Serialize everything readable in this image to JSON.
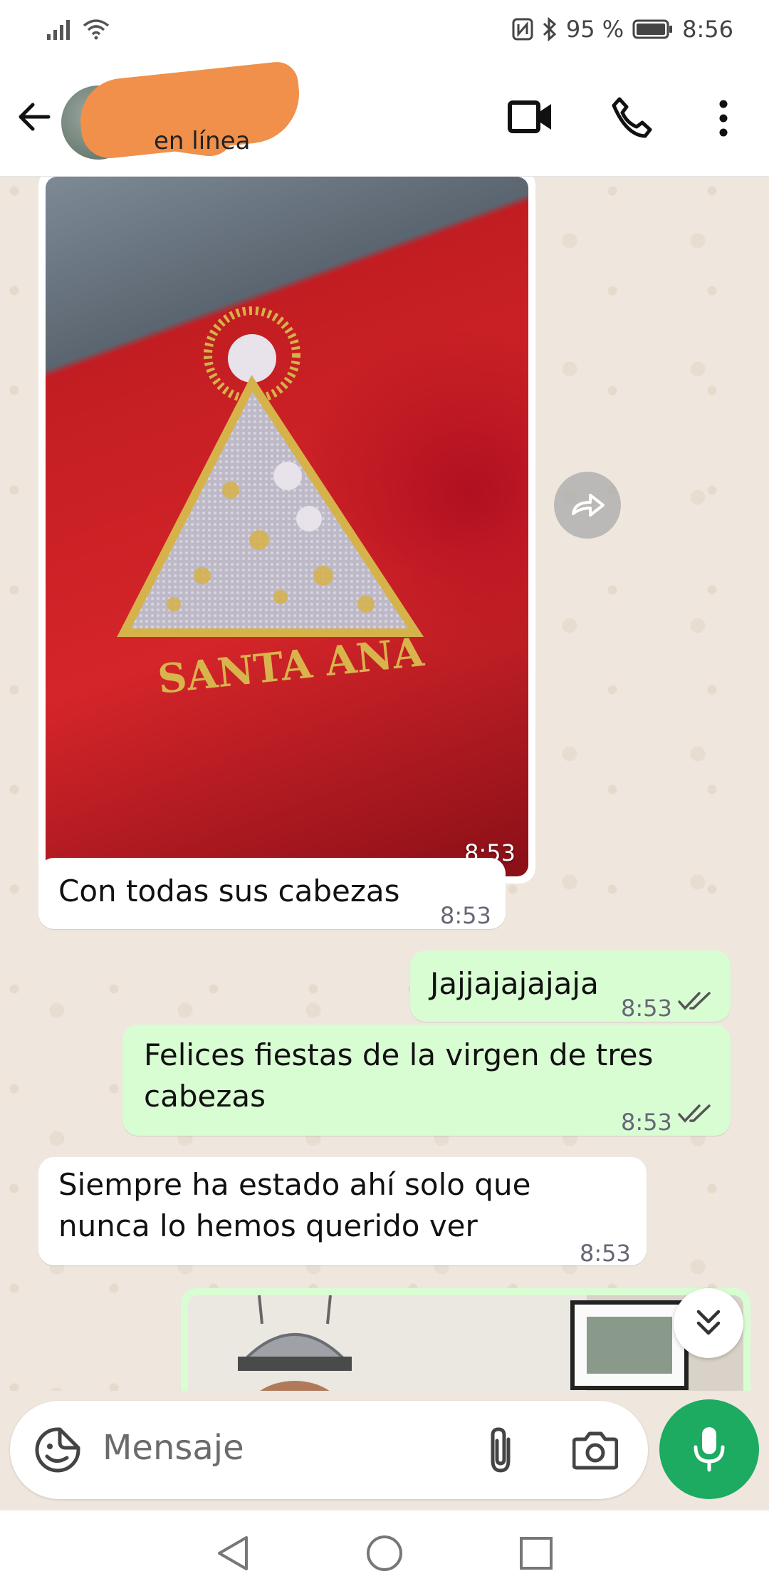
{
  "status_bar": {
    "battery": "95 %",
    "time": "8:56"
  },
  "header": {
    "status": "en línea"
  },
  "messages": [
    {
      "id": "img1",
      "type": "image",
      "direction": "in",
      "embroidery_text": "SANTA ANA",
      "time": "8:53"
    },
    {
      "id": "m1",
      "direction": "in",
      "text": "Con todas sus cabezas",
      "time": "8:53"
    },
    {
      "id": "m2",
      "direction": "out",
      "text": "Jajjajajajaja",
      "time": "8:53"
    },
    {
      "id": "m3",
      "direction": "out",
      "text": "Felices fiestas de la virgen de tres cabezas",
      "line1": "Felices fiestas de la virgen de tres",
      "line2": "cabezas",
      "time": "8:53"
    },
    {
      "id": "m4",
      "direction": "in",
      "text": "Siempre ha estado ahí solo que nunca lo hemos querido ver",
      "line1": "Siempre ha estado ahí solo que",
      "line2": "nunca lo hemos querido ver",
      "time": "8:53"
    },
    {
      "id": "img2",
      "type": "image",
      "direction": "out"
    }
  ],
  "input": {
    "placeholder": "Mensaje"
  },
  "colors": {
    "accent_green": "#1daa61",
    "outgoing_bubble": "#d9fdd3",
    "incoming_bubble": "#ffffff",
    "chat_bg": "#efe7de",
    "redaction": "#f0904a"
  },
  "icons": [
    "signal-icon",
    "wifi-icon",
    "nfc-icon",
    "bluetooth-icon",
    "battery-icon",
    "back-arrow-icon",
    "video-call-icon",
    "phone-icon",
    "more-vert-icon",
    "forward-icon",
    "scroll-down-icon",
    "sticker-icon",
    "attach-icon",
    "camera-icon",
    "mic-icon",
    "nav-back-icon",
    "nav-home-icon",
    "nav-recents-icon"
  ]
}
